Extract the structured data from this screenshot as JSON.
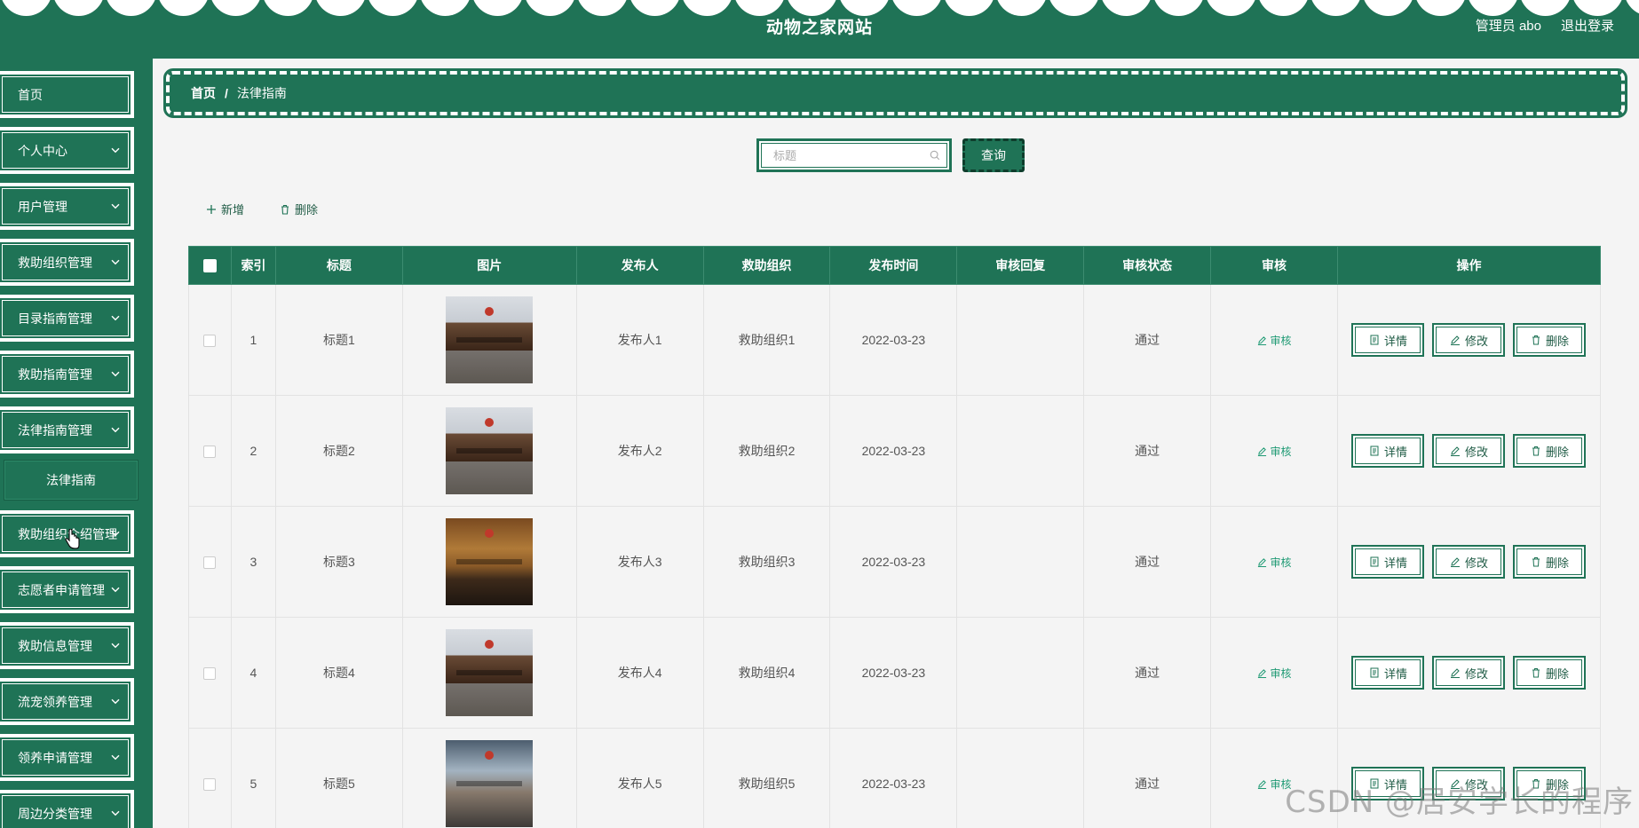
{
  "header": {
    "title": "动物之家网站",
    "user": "管理员 abo",
    "logout": "退出登录"
  },
  "sidebar": {
    "items": [
      {
        "label": "首页",
        "expandable": false
      },
      {
        "label": "个人中心",
        "expandable": true
      },
      {
        "label": "用户管理",
        "expandable": true
      },
      {
        "label": "救助组织管理",
        "expandable": true
      },
      {
        "label": "目录指南管理",
        "expandable": true
      },
      {
        "label": "救助指南管理",
        "expandable": true
      },
      {
        "label": "法律指南管理",
        "expandable": true
      },
      {
        "label": "救助组织介绍管理",
        "expandable": true
      },
      {
        "label": "志愿者申请管理",
        "expandable": true
      },
      {
        "label": "救助信息管理",
        "expandable": true
      },
      {
        "label": "流宠领养管理",
        "expandable": true
      },
      {
        "label": "领养申请管理",
        "expandable": true
      },
      {
        "label": "周边分类管理",
        "expandable": true
      }
    ],
    "active_sub": "法律指南"
  },
  "breadcrumb": {
    "home": "首页",
    "separator": "/",
    "current": "法律指南"
  },
  "search": {
    "placeholder": "标题",
    "button": "查询"
  },
  "toolbar": {
    "add": "新增",
    "delete": "删除"
  },
  "table": {
    "headers": [
      "索引",
      "标题",
      "图片",
      "发布人",
      "救助组织",
      "发布时间",
      "审核回复",
      "审核状态",
      "审核",
      "操作"
    ],
    "approve_label": "审核",
    "op_labels": {
      "detail": "详情",
      "edit": "修改",
      "delete": "删除"
    },
    "rows": [
      {
        "index": "1",
        "title": "标题1",
        "publisher": "发布人1",
        "org": "救助组织1",
        "date": "2022-03-23",
        "reply": "",
        "status": "通过",
        "image": "courtroom"
      },
      {
        "index": "2",
        "title": "标题2",
        "publisher": "发布人2",
        "org": "救助组织2",
        "date": "2022-03-23",
        "reply": "",
        "status": "通过",
        "image": "courtroom"
      },
      {
        "index": "3",
        "title": "标题3",
        "publisher": "发布人3",
        "org": "救助组织3",
        "date": "2022-03-23",
        "reply": "",
        "status": "通过",
        "image": "courtroom-wood"
      },
      {
        "index": "4",
        "title": "标题4",
        "publisher": "发布人4",
        "org": "救助组织4",
        "date": "2022-03-23",
        "reply": "",
        "status": "通过",
        "image": "courtroom"
      },
      {
        "index": "5",
        "title": "标题5",
        "publisher": "发布人5",
        "org": "救助组织5",
        "date": "2022-03-23",
        "reply": "",
        "status": "通过",
        "image": "courtroom-people"
      }
    ]
  },
  "watermark": "CSDN @居安学长的程序",
  "colors": {
    "primary": "#1f7356",
    "link": "#1f9a74"
  }
}
